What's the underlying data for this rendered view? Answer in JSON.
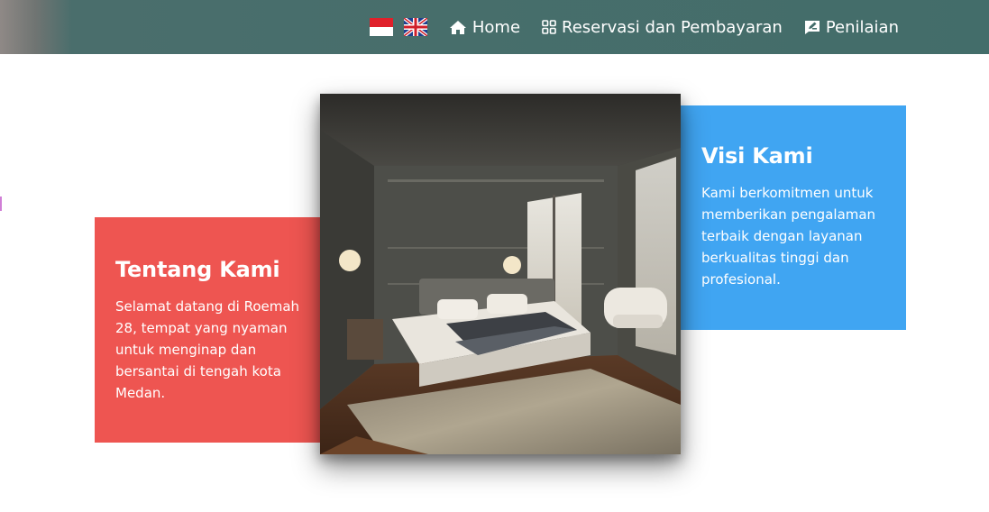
{
  "nav": {
    "flags": [
      {
        "name": "indonesia-flag",
        "colors": [
          "#e0202a",
          "#ffffff"
        ]
      },
      {
        "name": "uk-flag",
        "colors": [
          "#1f3f8f",
          "#ffffff",
          "#d0202a"
        ]
      }
    ],
    "links": [
      {
        "icon": "home-icon",
        "label": "Home"
      },
      {
        "icon": "grid-icon",
        "label": "Reservasi dan Pembayaran"
      },
      {
        "icon": "review-icon",
        "label": "Penilaian"
      }
    ]
  },
  "about": {
    "title": "Tentang Kami",
    "text": "Selamat datang di Roemah 28, tempat yang nyaman untuk menginap dan bersantai di tengah kota Medan."
  },
  "vision": {
    "title": "Visi Kami",
    "text": "Kami berkomitmen untuk memberikan pengalaman terbaik dengan layanan berkualitas tinggi dan profesional."
  },
  "colors": {
    "navbar": "#436d6a",
    "about_card": "#ee5551",
    "vision_card": "#40a5f2"
  }
}
